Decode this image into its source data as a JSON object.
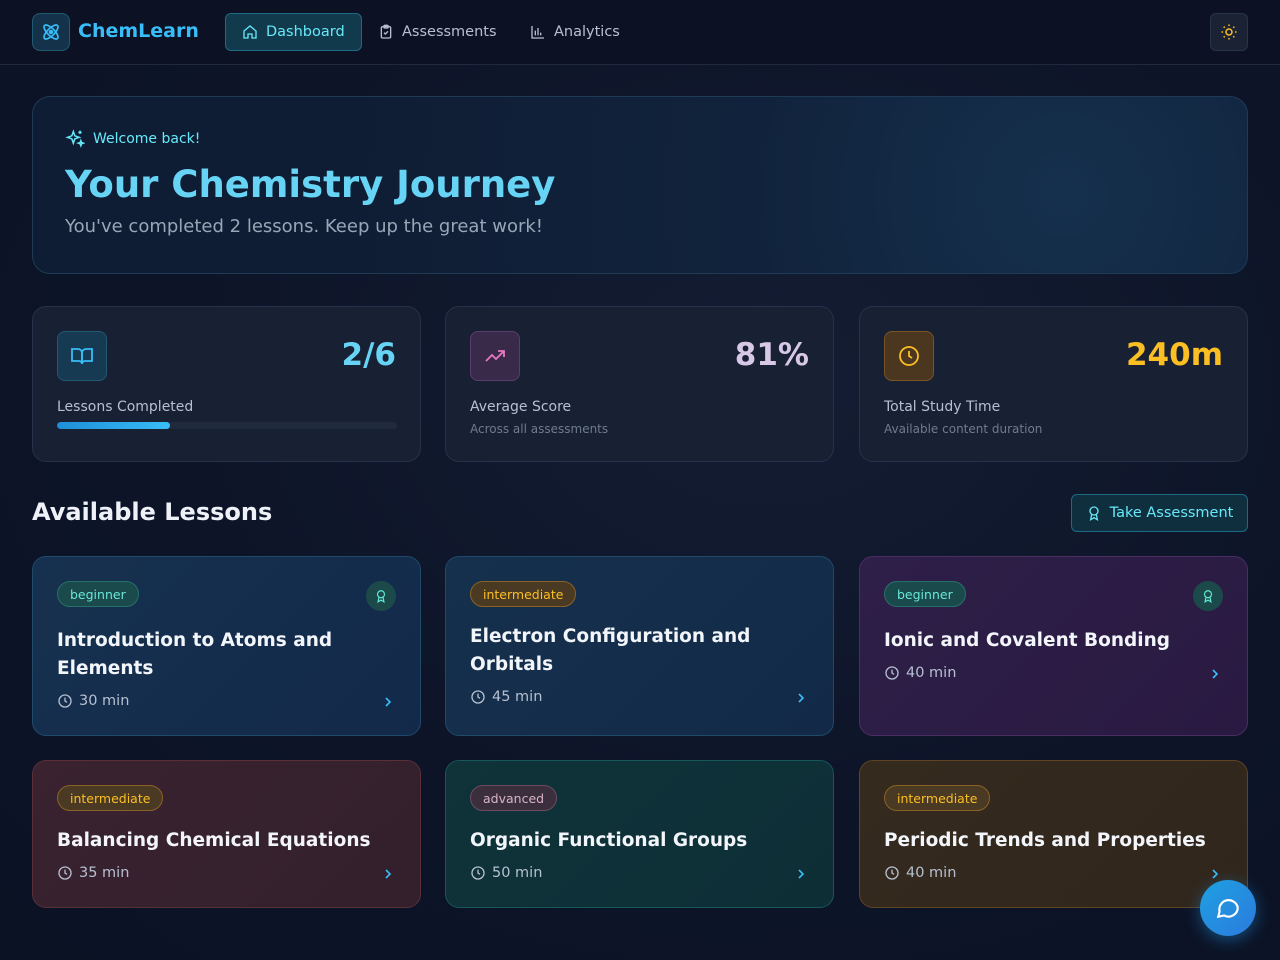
{
  "app": {
    "name": "ChemLearn"
  },
  "nav": {
    "items": [
      {
        "label": "Dashboard",
        "icon": "home-icon",
        "active": true
      },
      {
        "label": "Assessments",
        "icon": "clipboard-icon",
        "active": false
      },
      {
        "label": "Analytics",
        "icon": "bar-chart-icon",
        "active": false
      }
    ],
    "theme_toggle_icon": "sun-icon"
  },
  "hero": {
    "tag": "Welcome back!",
    "title": "Your Chemistry Journey",
    "subtitle": "You've completed 2 lessons. Keep up the great work!"
  },
  "stats": [
    {
      "value": "2/6",
      "label": "Lessons Completed",
      "progress": 0.333,
      "icon": "book-open-icon",
      "color": "#67d4f5"
    },
    {
      "value": "81%",
      "label": "Average Score",
      "sub": "Across all assessments",
      "icon": "trending-up-icon",
      "color": "#d8c8e8"
    },
    {
      "value": "240m",
      "label": "Total Study Time",
      "sub": "Available content duration",
      "icon": "clock-icon",
      "color": "#fbbf24"
    }
  ],
  "section": {
    "title": "Available Lessons",
    "assessment_button": "Take Assessment"
  },
  "lessons": [
    {
      "level": "beginner",
      "title": "Introduction to Atoms and Elements",
      "duration": "30 min",
      "completed": true
    },
    {
      "level": "intermediate",
      "title": "Electron Configuration and Orbitals",
      "duration": "45 min",
      "completed": false
    },
    {
      "level": "beginner",
      "title": "Ionic and Covalent Bonding",
      "duration": "40 min",
      "completed": true
    },
    {
      "level": "intermediate",
      "title": "Balancing Chemical Equations",
      "duration": "35 min",
      "completed": false
    },
    {
      "level": "advanced",
      "title": "Organic Functional Groups",
      "duration": "50 min",
      "completed": false
    },
    {
      "level": "intermediate",
      "title": "Periodic Trends and Properties",
      "duration": "40 min",
      "completed": false
    }
  ],
  "chat": {
    "icon": "chat-icon"
  }
}
